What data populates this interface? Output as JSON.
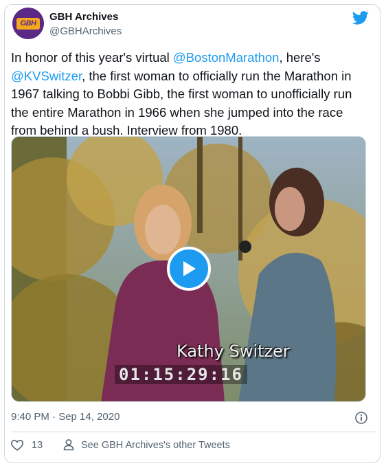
{
  "author": {
    "name": "GBH Archives",
    "handle": "@GBHArchives",
    "avatar_text": "GBH"
  },
  "tweet": {
    "text_1": "In honor of this year's virtual ",
    "mention_1": "@BostonMarathon",
    "text_2": ", here's ",
    "mention_2": "@KVSwitzer",
    "text_3": ", the first woman to officially run the Marathon in 1967 talking to Bobbi Gibb, the first woman to unofficially run the entire Marathon in 1966 when she jumped into the race from behind a bush. Interview from 1980."
  },
  "video": {
    "caption": "Kathy Switzer",
    "timecode": "01:15:29:16"
  },
  "meta": {
    "timestamp": "9:40 PM · Sep 14, 2020"
  },
  "actions": {
    "like_count": "13",
    "other_tweets_label": "See GBH Archives's other Tweets"
  },
  "colors": {
    "accent": "#1d9bf0",
    "secondary_text": "#536471",
    "border": "#cfd9de"
  },
  "icons": [
    "twitter-bird-icon",
    "play-icon",
    "info-icon",
    "heart-icon",
    "person-icon"
  ]
}
